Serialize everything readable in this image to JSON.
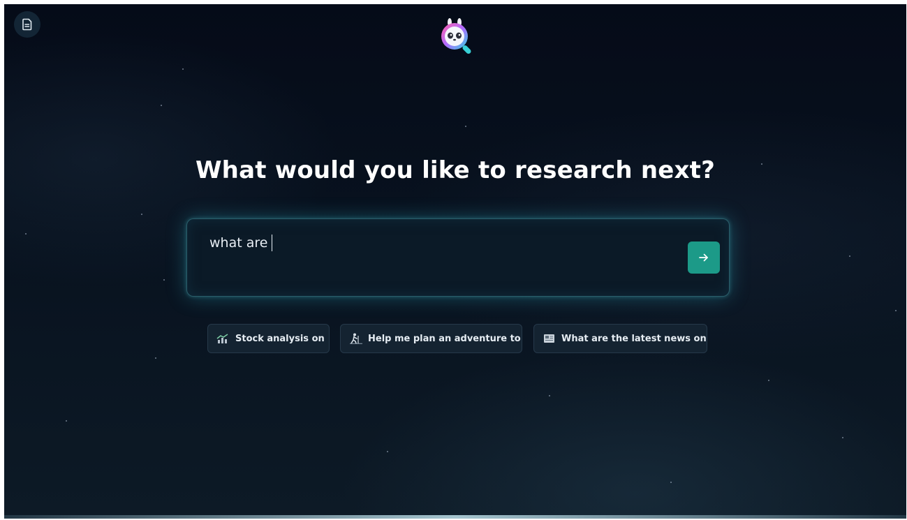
{
  "headline": "What would you like to research next?",
  "search": {
    "value": "what are",
    "submit_icon": "arrow-right-icon"
  },
  "suggestions": [
    {
      "icon": "chart-icon",
      "label": "Stock analysis on"
    },
    {
      "icon": "hiker-icon",
      "label": "Help me plan an adventure to"
    },
    {
      "icon": "newspaper-icon",
      "label": "What are the latest news on"
    }
  ],
  "header": {
    "left_button_icon": "document-icon",
    "logo": "panda-magnifier-logo"
  },
  "colors": {
    "background": "#07111d",
    "accent": "#1c9a88",
    "chip_background": "#142331",
    "text": "#ffffff"
  }
}
